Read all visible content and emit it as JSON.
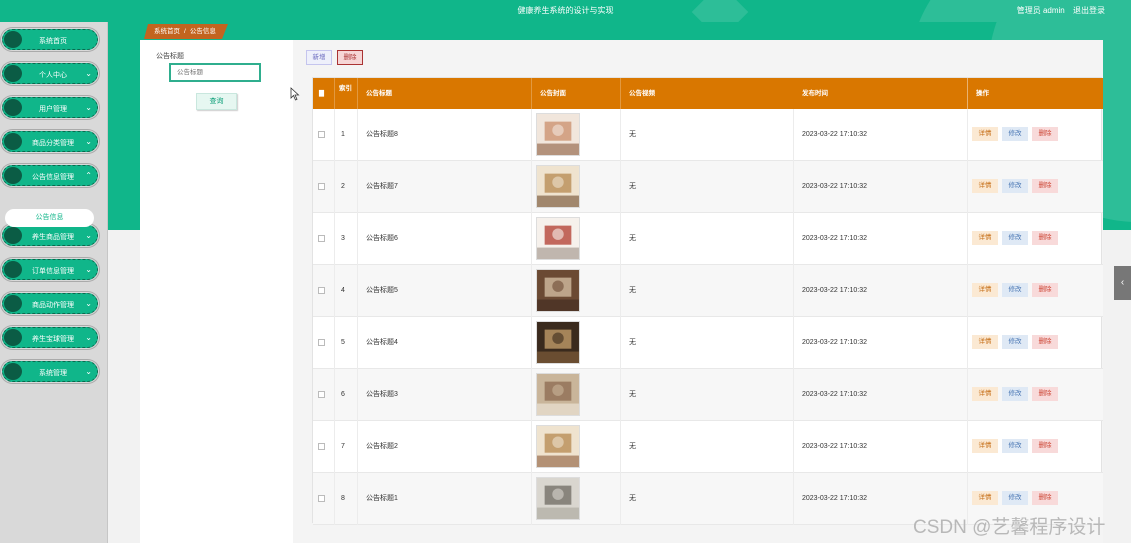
{
  "header": {
    "title": "健康养生系统的设计与实现",
    "user": "管理员 admin",
    "logout": "退出登录"
  },
  "sidebar": {
    "items": [
      {
        "label": "系统首页",
        "has_arrow": false
      },
      {
        "label": "个人中心",
        "has_arrow": true
      },
      {
        "label": "用户管理",
        "has_arrow": true
      },
      {
        "label": "商品分类管理",
        "has_arrow": true
      },
      {
        "label": "公告信息管理",
        "has_arrow": true,
        "expanded": true
      },
      {
        "label": "养生商品管理",
        "has_arrow": true
      },
      {
        "label": "订单信息管理",
        "has_arrow": true
      },
      {
        "label": "商品动作管理",
        "has_arrow": true
      },
      {
        "label": "养生宝球管理",
        "has_arrow": true
      },
      {
        "label": "系统管理",
        "has_arrow": true
      }
    ],
    "active_sub": "公告信息"
  },
  "breadcrumb": {
    "home": "系统首页",
    "separator": "/",
    "current": "公告信息"
  },
  "search": {
    "label": "公告标题",
    "placeholder": "公告标题",
    "button": "查询"
  },
  "toolbar": {
    "add": "新增",
    "delete": "删除"
  },
  "table": {
    "headers": [
      "索引",
      "公告标题",
      "公告封面",
      "公告视频",
      "发布时间",
      "操作"
    ],
    "actions": {
      "detail": "详情",
      "edit": "修改",
      "delete": "删除"
    },
    "rows": [
      {
        "index": "1",
        "title": "公告标题8",
        "video": "无",
        "time": "2023-03-22 17:10:32"
      },
      {
        "index": "2",
        "title": "公告标题7",
        "video": "无",
        "time": "2023-03-22 17:10:32"
      },
      {
        "index": "3",
        "title": "公告标题6",
        "video": "无",
        "time": "2023-03-22 17:10:32"
      },
      {
        "index": "4",
        "title": "公告标题5",
        "video": "无",
        "time": "2023-03-22 17:10:32"
      },
      {
        "index": "5",
        "title": "公告标题4",
        "video": "无",
        "time": "2023-03-22 17:10:32"
      },
      {
        "index": "6",
        "title": "公告标题3",
        "video": "无",
        "time": "2023-03-22 17:10:32"
      },
      {
        "index": "7",
        "title": "公告标题2",
        "video": "无",
        "time": "2023-03-22 17:10:32"
      },
      {
        "index": "8",
        "title": "公告标题1",
        "video": "无",
        "time": "2023-03-22 17:10:32"
      }
    ]
  },
  "watermark": "CSDN @艺馨程序设计",
  "colors": {
    "brand": "#10b68a",
    "table_header": "#d97700",
    "breadcrumb": "#c2641f"
  }
}
